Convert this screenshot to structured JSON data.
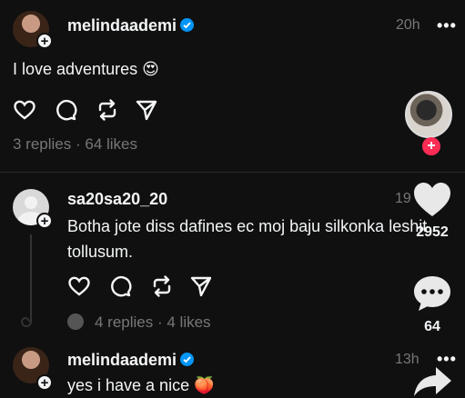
{
  "post": {
    "username": "melindaademi",
    "time": "20h",
    "more": "•••",
    "text": "I love adventures",
    "emoji": "😍",
    "stats": "3 replies · 64 likes"
  },
  "reply": {
    "username": "sa20sa20_20",
    "time": "19",
    "text_line1": "Botha jote diss dafines ec moj baju silkonka leshit",
    "text_line2": "tollusum.",
    "stats": "4 replies · 4 likes"
  },
  "reply2": {
    "username": "melindaademi",
    "time": "13h",
    "more": "•••",
    "text": "yes i have a nice",
    "emoji": "🍑"
  },
  "side": {
    "like_count": "2952",
    "comment_count": "64"
  },
  "colors": {
    "background": "#101010",
    "text": "#f3f5f7",
    "muted": "#777777",
    "verified": "#0095f6",
    "follow_badge": "#fe2c55"
  }
}
